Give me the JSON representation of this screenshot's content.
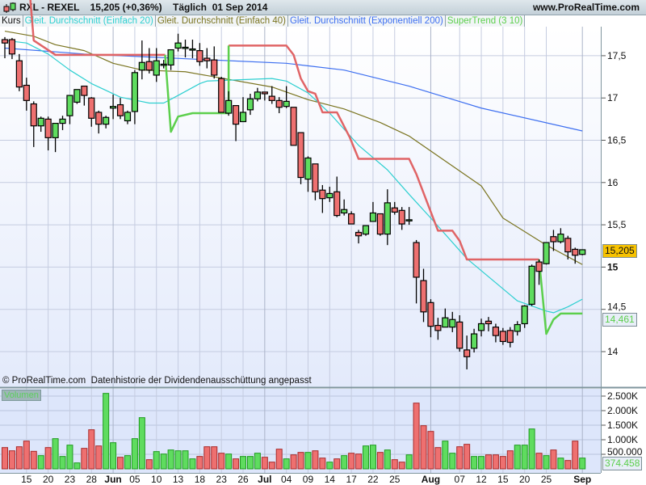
{
  "header": {
    "symbol": "RXL - REXEL",
    "price_change": "15,205 (+0,36%)",
    "period": "Täglich",
    "date": "01 Sep 2014",
    "site": "www.ProRealTime.com",
    "icon": "candlestick-logo-icon"
  },
  "legend": {
    "price": "Kurs",
    "sma20": "Gleit. Durchschnitt (Einfach 20)",
    "sma40": "Gleit. Durchschnitt (Einfach 40)",
    "ema200": "Gleit. Durchschnitt (Exponentiell 200)",
    "supertrend": "SuperTrend (3 10)"
  },
  "colors": {
    "up": "#5fdc5f",
    "down": "#ee7070",
    "sma20": "#2ccfd0",
    "sma40": "#7a7420",
    "ema200": "#3d6ff0",
    "st_up": "#5ccf4c",
    "st_down": "#e06466",
    "last_tag": "#f7c200"
  },
  "footer": {
    "copyright": "© ProRealTime.com",
    "note": "Datenhistorie der Dividendenausschüttung angepasst"
  },
  "price_axis": {
    "labels": [
      "17,5",
      "17",
      "16,5",
      "16",
      "15,5",
      "15",
      "14,5",
      "14"
    ],
    "values": [
      17.5,
      17,
      16.5,
      16,
      15.5,
      15,
      14.5,
      14
    ],
    "last_price": "15,205",
    "supertrend_value": "14,461"
  },
  "volume_axis": {
    "title": "Volumen",
    "labels": [
      "2.500K",
      "2.000K",
      "1.500K",
      "1.000K",
      "500.000"
    ],
    "values": [
      2500,
      2000,
      1500,
      1000,
      500
    ],
    "last_volume": "374.458"
  },
  "date_axis": {
    "labels": [
      "15",
      "20",
      "23",
      "28",
      "Jun",
      "05",
      "10",
      "13",
      "18",
      "23",
      "26",
      "Jul",
      "04",
      "09",
      "14",
      "17",
      "22",
      "25",
      "Aug",
      "07",
      "12",
      "15",
      "20",
      "25",
      "Sep"
    ],
    "index": [
      3,
      6,
      9,
      12,
      15,
      18,
      21,
      24,
      27,
      30,
      33,
      36,
      39,
      42,
      45,
      48,
      51,
      54,
      59,
      63,
      66,
      69,
      72,
      75,
      80
    ],
    "bold": [
      false,
      false,
      false,
      false,
      true,
      false,
      false,
      false,
      false,
      false,
      false,
      true,
      false,
      false,
      false,
      false,
      false,
      false,
      true,
      false,
      false,
      false,
      false,
      false,
      true
    ]
  },
  "chart_data": {
    "type": "candlestick",
    "ylim": [
      13.6,
      17.95
    ],
    "candles_ohlc": [
      [
        17.69,
        17.72,
        17.47,
        17.65
      ],
      [
        17.69,
        17.71,
        17.46,
        17.52
      ],
      [
        17.44,
        17.52,
        17.08,
        17.13
      ],
      [
        17.15,
        17.24,
        16.85,
        16.97
      ],
      [
        16.93,
        16.96,
        16.42,
        16.67
      ],
      [
        16.67,
        16.78,
        16.6,
        16.76
      ],
      [
        16.75,
        16.78,
        16.38,
        16.53
      ],
      [
        16.53,
        16.7,
        16.36,
        16.7
      ],
      [
        16.7,
        16.79,
        16.62,
        16.75
      ],
      [
        16.79,
        17.03,
        16.69,
        17.03
      ],
      [
        16.95,
        17.1,
        16.93,
        17.1
      ],
      [
        17.14,
        17.14,
        16.91,
        17.03
      ],
      [
        17.0,
        17.01,
        16.66,
        16.76
      ],
      [
        16.83,
        16.85,
        16.58,
        16.69
      ],
      [
        16.69,
        16.79,
        16.64,
        16.77
      ],
      [
        16.88,
        17.04,
        16.75,
        16.9
      ],
      [
        16.92,
        17.0,
        16.75,
        16.79
      ],
      [
        16.73,
        16.85,
        16.69,
        16.83
      ],
      [
        16.84,
        17.33,
        16.69,
        17.3
      ],
      [
        17.33,
        17.68,
        17.22,
        17.42
      ],
      [
        17.43,
        17.59,
        17.29,
        17.33
      ],
      [
        17.27,
        17.59,
        17.19,
        17.44
      ],
      [
        17.4,
        17.45,
        17.35,
        17.4
      ],
      [
        17.39,
        17.57,
        17.33,
        17.57
      ],
      [
        17.59,
        17.76,
        17.55,
        17.65
      ],
      [
        17.59,
        17.69,
        17.48,
        17.6
      ],
      [
        17.58,
        17.69,
        17.47,
        17.58
      ],
      [
        17.56,
        17.65,
        17.38,
        17.43
      ],
      [
        17.47,
        17.59,
        17.35,
        17.44
      ],
      [
        17.45,
        17.61,
        17.23,
        17.27
      ],
      [
        17.23,
        17.25,
        16.83,
        16.83
      ],
      [
        16.82,
        17.08,
        16.79,
        16.97
      ],
      [
        16.91,
        16.91,
        16.49,
        16.69
      ],
      [
        16.72,
        17.01,
        16.72,
        16.83
      ],
      [
        16.86,
        17.05,
        16.8,
        16.99
      ],
      [
        16.99,
        17.12,
        16.96,
        17.07
      ],
      [
        17.07,
        17.07,
        16.97,
        17.05
      ],
      [
        17.02,
        17.14,
        16.93,
        16.97
      ],
      [
        16.97,
        17.01,
        16.82,
        16.89
      ],
      [
        16.9,
        17.14,
        16.88,
        16.96
      ],
      [
        16.89,
        16.89,
        16.44,
        16.44
      ],
      [
        16.59,
        16.59,
        15.98,
        16.06
      ],
      [
        16.04,
        16.31,
        15.89,
        16.29
      ],
      [
        16.22,
        16.22,
        15.79,
        15.89
      ],
      [
        15.91,
        15.97,
        15.64,
        15.81
      ],
      [
        15.82,
        15.95,
        15.77,
        15.87
      ],
      [
        15.89,
        16.07,
        15.59,
        15.61
      ],
      [
        15.64,
        15.8,
        15.61,
        15.68
      ],
      [
        15.63,
        15.66,
        15.51,
        15.51
      ],
      [
        15.41,
        15.44,
        15.28,
        15.37
      ],
      [
        15.39,
        15.49,
        15.37,
        15.49
      ],
      [
        15.54,
        15.77,
        15.54,
        15.64
      ],
      [
        15.63,
        15.63,
        15.37,
        15.39
      ],
      [
        15.39,
        15.92,
        15.26,
        15.76
      ],
      [
        15.7,
        15.77,
        15.62,
        15.65
      ],
      [
        15.67,
        15.71,
        15.44,
        15.51
      ],
      [
        15.56,
        15.71,
        15.5,
        15.56
      ],
      [
        15.29,
        15.32,
        14.57,
        14.88
      ],
      [
        14.84,
        14.98,
        14.35,
        14.47
      ],
      [
        14.58,
        14.62,
        14.17,
        14.3
      ],
      [
        14.31,
        14.4,
        14.14,
        14.25
      ],
      [
        14.29,
        14.51,
        14.29,
        14.4
      ],
      [
        14.29,
        14.47,
        14.23,
        14.38
      ],
      [
        14.35,
        14.43,
        14.0,
        14.04
      ],
      [
        14.02,
        14.19,
        13.79,
        13.94
      ],
      [
        14.04,
        14.27,
        13.99,
        14.21
      ],
      [
        14.25,
        14.39,
        14.18,
        14.33
      ],
      [
        14.36,
        14.41,
        14.24,
        14.33
      ],
      [
        14.29,
        14.33,
        14.11,
        14.19
      ],
      [
        14.24,
        14.28,
        14.08,
        14.12
      ],
      [
        14.25,
        14.29,
        14.05,
        14.11
      ],
      [
        14.24,
        14.36,
        14.19,
        14.32
      ],
      [
        14.33,
        14.55,
        14.28,
        14.54
      ],
      [
        14.56,
        15.03,
        14.54,
        15.01
      ],
      [
        15.06,
        15.09,
        14.79,
        14.95
      ],
      [
        15.04,
        15.29,
        15.03,
        15.29
      ],
      [
        15.36,
        15.44,
        15.19,
        15.3
      ],
      [
        15.3,
        15.46,
        15.28,
        15.39
      ],
      [
        15.34,
        15.37,
        15.09,
        15.18
      ],
      [
        15.21,
        15.23,
        15.04,
        15.14
      ],
      [
        15.15,
        15.21,
        15.14,
        15.205
      ]
    ],
    "volume_k": [
      731,
      620,
      759,
      954,
      602,
      454,
      731,
      1037,
      426,
      815,
      204,
      704,
      1343,
      787,
      2593,
      898,
      398,
      454,
      1037,
      1759,
      315,
      593,
      509,
      648,
      620,
      620,
      343,
      426,
      759,
      759,
      537,
      509,
      343,
      426,
      426,
      537,
      398,
      231,
      676,
      343,
      481,
      565,
      565,
      620,
      370,
      231,
      343,
      454,
      537,
      509,
      787,
      815,
      565,
      648,
      315,
      231,
      481,
      2259,
      1482,
      1287,
      731,
      954,
      537,
      759,
      843,
      426,
      426,
      481,
      481,
      426,
      620,
      815,
      815,
      1370,
      537,
      454,
      648,
      370,
      287,
      954,
      370
    ],
    "sma20": [
      [
        0,
        17.68
      ],
      [
        3,
        17.65
      ],
      [
        6,
        17.52
      ],
      [
        9,
        17.33
      ],
      [
        12,
        17.17
      ],
      [
        16,
        17.01
      ],
      [
        20,
        16.94
      ],
      [
        22,
        16.94
      ],
      [
        24,
        17.03
      ],
      [
        27,
        17.17
      ],
      [
        28,
        17.2
      ],
      [
        37,
        17.23
      ],
      [
        39,
        17.2
      ],
      [
        42,
        17.06
      ],
      [
        45,
        16.82
      ],
      [
        49,
        16.44
      ],
      [
        53,
        16.15
      ],
      [
        56,
        15.86
      ],
      [
        59,
        15.58
      ],
      [
        64,
        15.1
      ],
      [
        71,
        14.6
      ],
      [
        75,
        14.48
      ],
      [
        76,
        14.46
      ],
      [
        78,
        14.53
      ],
      [
        80,
        14.62
      ]
    ],
    "sma40": [
      [
        0,
        17.79
      ],
      [
        4,
        17.73
      ],
      [
        7,
        17.63
      ],
      [
        11,
        17.56
      ],
      [
        15,
        17.41
      ],
      [
        19,
        17.33
      ],
      [
        25,
        17.31
      ],
      [
        27,
        17.28
      ],
      [
        37,
        17.13
      ],
      [
        42,
        16.98
      ],
      [
        47,
        16.87
      ],
      [
        52,
        16.71
      ],
      [
        56,
        16.55
      ],
      [
        66,
        15.96
      ],
      [
        69,
        15.58
      ],
      [
        75,
        15.26
      ],
      [
        80,
        15.03
      ]
    ],
    "ema200": [
      [
        0,
        17.59
      ],
      [
        11,
        17.52
      ],
      [
        26,
        17.46
      ],
      [
        39,
        17.41
      ],
      [
        47,
        17.33
      ],
      [
        56,
        17.14
      ],
      [
        66,
        16.88
      ],
      [
        80,
        16.61
      ]
    ],
    "supertrend_down": [
      [
        [
          3.5,
          18.2
        ],
        [
          4,
          17.68
        ],
        [
          7,
          17.51
        ],
        [
          22.2,
          17.51
        ]
      ],
      [
        [
          31,
          17.62
        ],
        [
          32,
          17.62
        ],
        [
          39,
          17.62
        ],
        [
          40,
          17.51
        ],
        [
          41,
          17.23
        ],
        [
          42,
          17.08
        ],
        [
          43,
          17.05
        ],
        [
          44,
          16.83
        ],
        [
          46,
          16.83
        ],
        [
          47.8,
          16.53
        ],
        [
          49,
          16.28
        ],
        [
          56,
          16.28
        ],
        [
          57,
          16.1
        ],
        [
          60,
          15.43
        ],
        [
          62,
          15.43
        ],
        [
          63,
          15.31
        ],
        [
          64,
          15.09
        ],
        [
          74,
          15.09
        ]
      ]
    ],
    "supertrend_up": [
      [
        [
          22.2,
          17.51
        ],
        [
          23,
          16.6
        ],
        [
          24,
          16.78
        ],
        [
          26,
          16.82
        ],
        [
          31,
          16.82
        ],
        [
          31,
          17.62
        ]
      ],
      [
        [
          74,
          15.09
        ],
        [
          75,
          14.21
        ],
        [
          76,
          14.38
        ],
        [
          77,
          14.45
        ],
        [
          80,
          14.45
        ]
      ]
    ]
  }
}
